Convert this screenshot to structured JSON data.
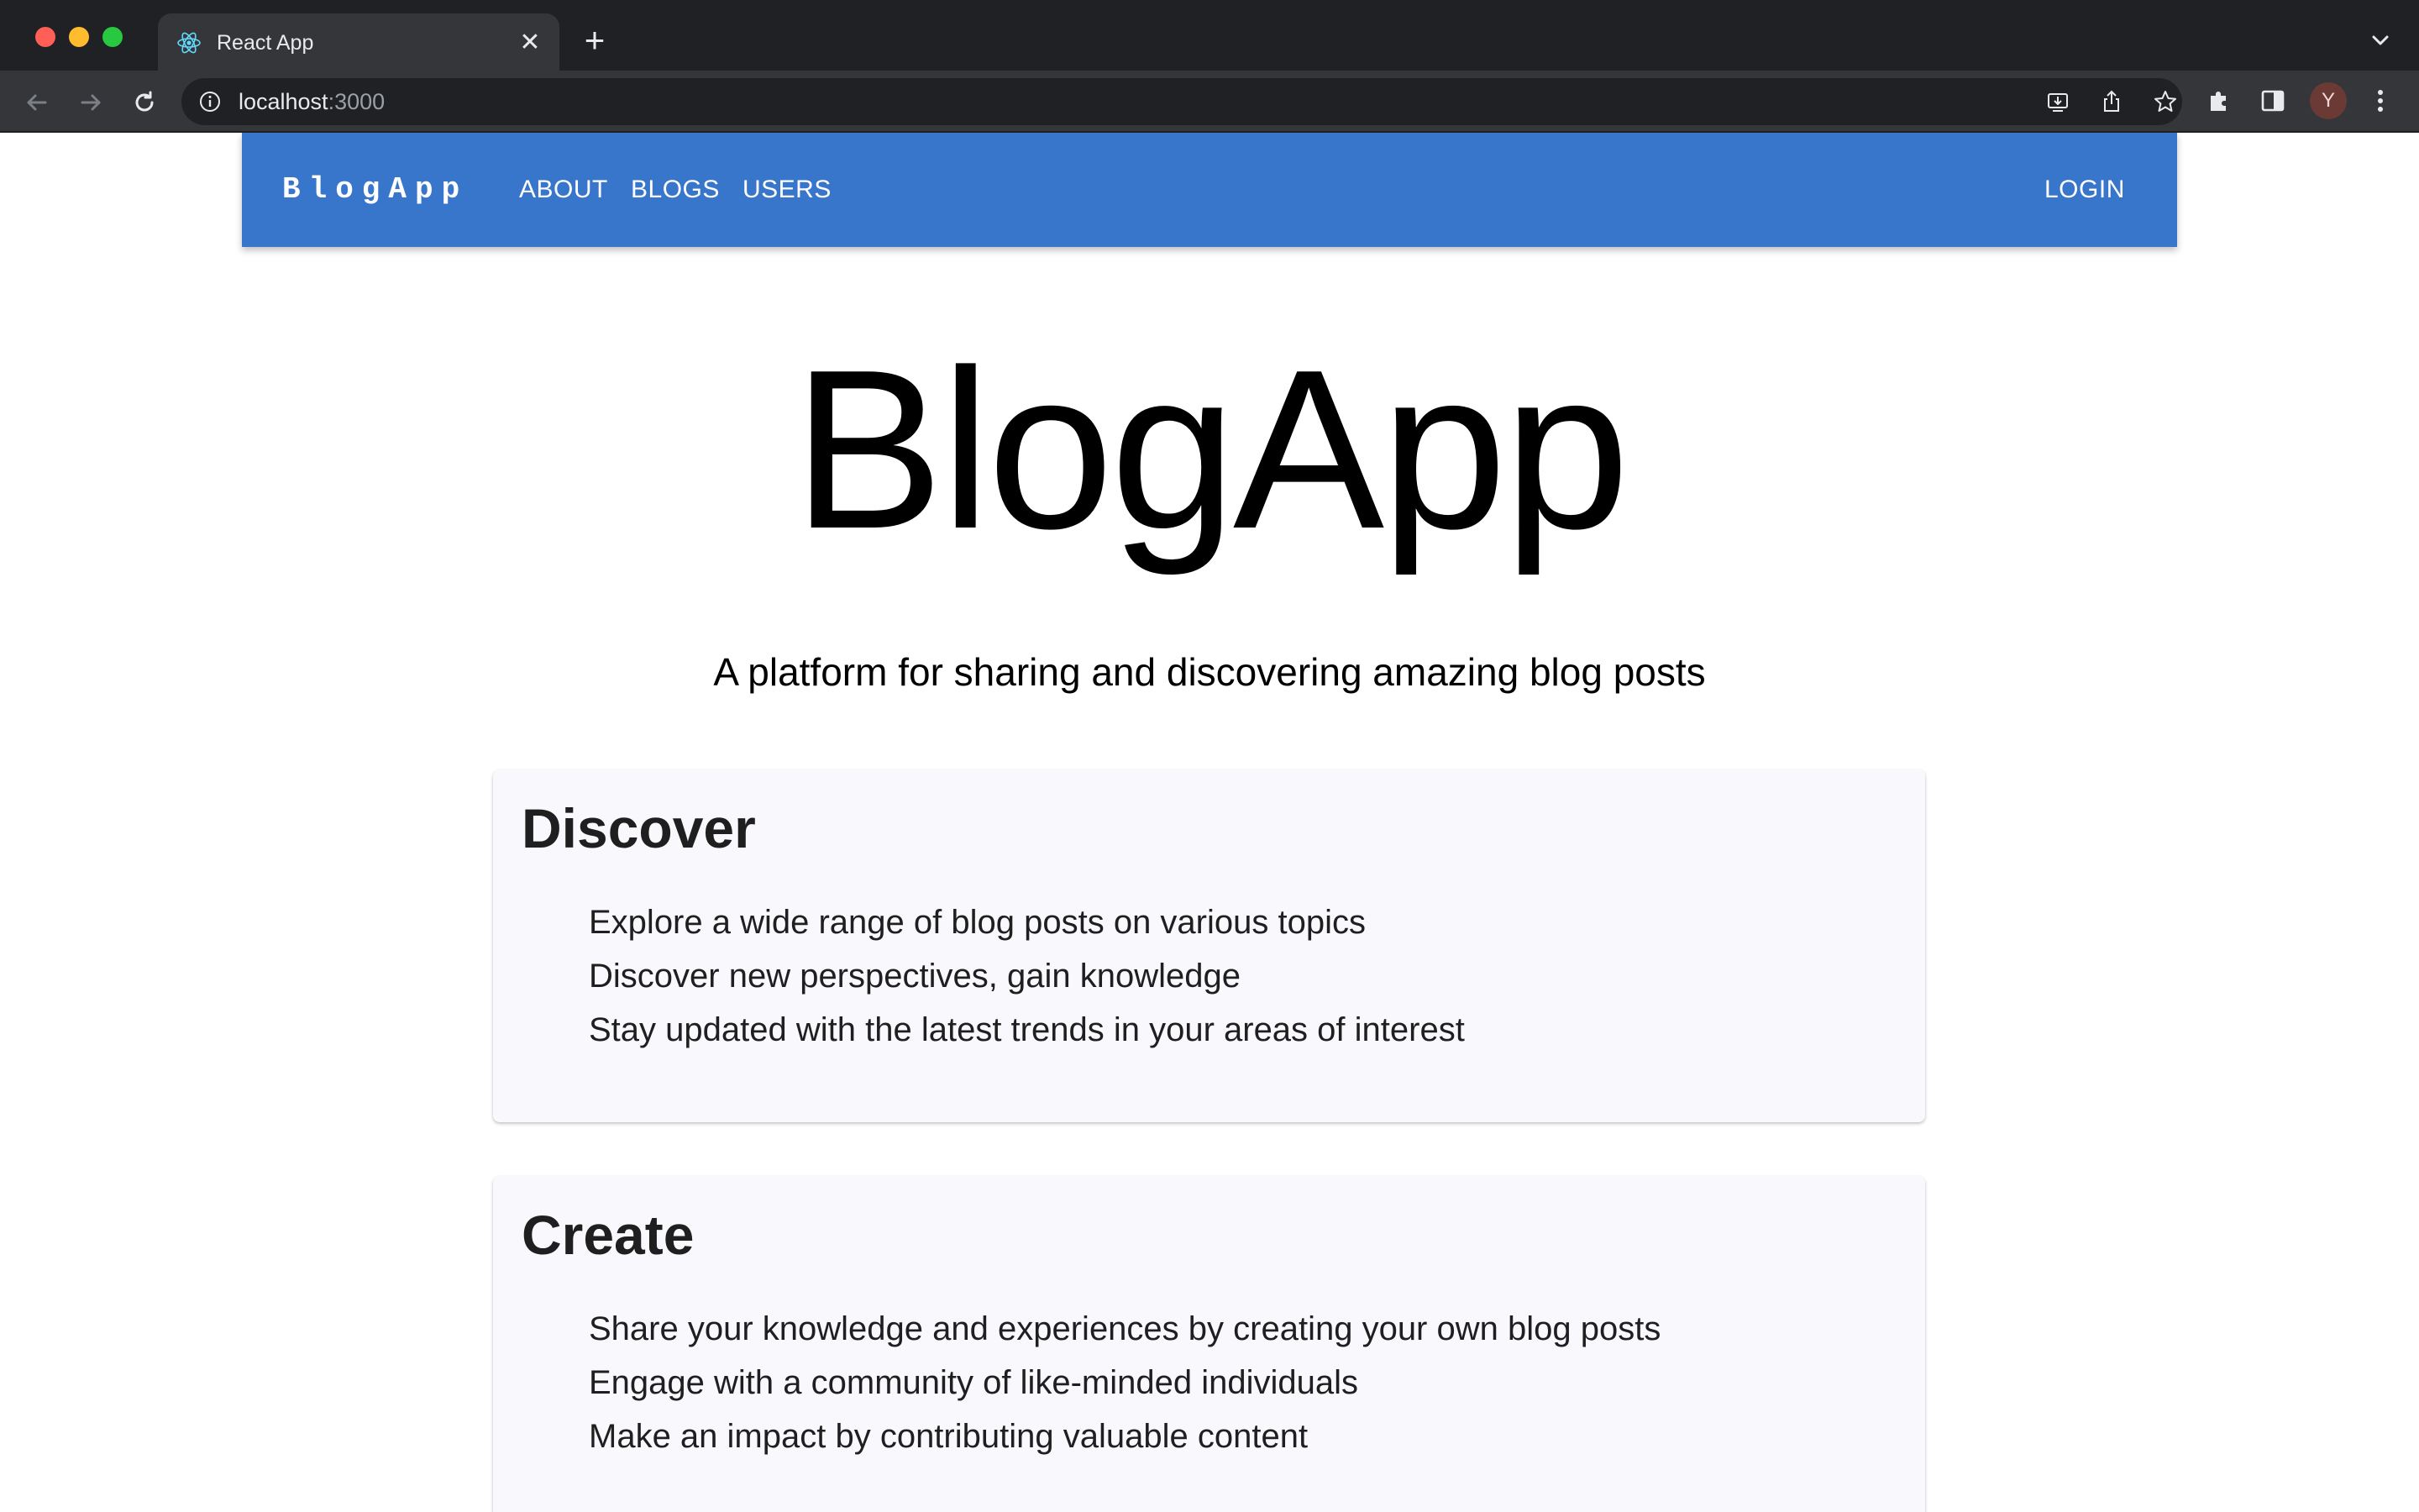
{
  "browser": {
    "tab_title": "React App",
    "tab_close": "✕",
    "new_tab": "+",
    "url_host": "localhost",
    "url_port": ":3000",
    "avatar_initial": "Y",
    "icons": [
      "react-favicon",
      "close-icon",
      "plus-icon",
      "chevron-down-icon",
      "back-arrow-icon",
      "forward-arrow-icon",
      "reload-icon",
      "info-icon",
      "install-icon",
      "share-icon",
      "star-icon",
      "puzzle-icon",
      "side-panel-icon",
      "more-vert-icon"
    ]
  },
  "appbar": {
    "brand": "BlogApp",
    "links": [
      "ABOUT",
      "BLOGS",
      "USERS"
    ],
    "login": "LOGIN",
    "color": "#3876cc"
  },
  "hero": {
    "title": "BlogApp",
    "subtitle": "A platform for sharing and discovering amazing blog posts"
  },
  "sections": [
    {
      "title": "Discover",
      "items": [
        "Explore a wide range of blog posts on various topics",
        "Discover new perspectives, gain knowledge",
        "Stay updated with the latest trends in your areas of interest"
      ]
    },
    {
      "title": "Create",
      "items": [
        "Share your knowledge and experiences by creating your own blog posts",
        "Engage with a community of like-minded individuals",
        "Make an impact by contributing valuable content"
      ]
    }
  ],
  "colors": {
    "card_background": "#f8f8fd",
    "chrome_dark": "#202124",
    "chrome_toolbar": "#35363a"
  }
}
